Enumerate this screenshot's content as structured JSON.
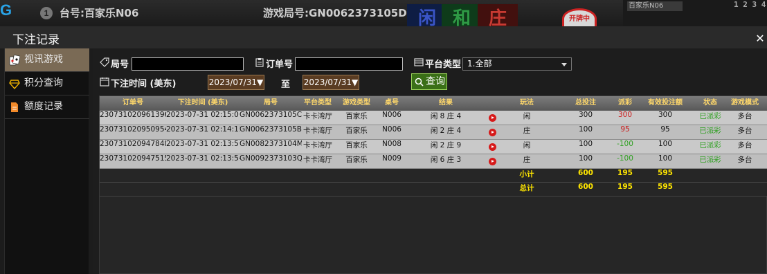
{
  "background": {
    "logo": "G",
    "table_badge_num": "1",
    "table_title": "台号:百家乐N06",
    "round_id": "游戏局号:GN0062373105D",
    "bet_player": "闲",
    "bet_tie": "和",
    "bet_banker": "庄",
    "badge_text": "开牌中",
    "right_label": "百家乐N06",
    "right_nums": "1 2 3 4"
  },
  "modal": {
    "title": "下注记录",
    "close_icon": "close-icon"
  },
  "sidebar": {
    "items": [
      {
        "label": "视讯游戏",
        "icon": "cards-icon",
        "active": true
      },
      {
        "label": "积分查询",
        "icon": "diamond-icon",
        "active": false
      },
      {
        "label": "额度记录",
        "icon": "document-icon",
        "active": false
      }
    ]
  },
  "filters": {
    "round_label": "局号",
    "order_label": "订单号",
    "platform_label": "平台类型",
    "platform_value": "1.全部",
    "time_label": "下注时间 (美东)",
    "date_from": "2023/07/31▼",
    "to_label": "至",
    "date_to": "2023/07/31▼",
    "query_label": "查询",
    "round_value": "",
    "order_value": ""
  },
  "table": {
    "columns": [
      "订单号",
      "下注时间 (美东)",
      "局号",
      "平台类型",
      "游戏类型",
      "桌号",
      "结果",
      "",
      "玩法",
      "总投注",
      "派彩",
      "有效投注额",
      "状态",
      "游戏模式"
    ],
    "rows": [
      {
        "order": "230731020961396",
        "time": "2023-07-31 02:15:01",
        "round": "GN0062373105C",
        "platform": "卡卡湾厅",
        "game": "百家乐",
        "table_no": "N006",
        "result": "闲 8 庄 4",
        "play": "闲",
        "bet": "300",
        "payout": "300",
        "payout_color": "#cc1b1b",
        "valid": "300",
        "status": "已派彩",
        "mode": "多台"
      },
      {
        "order": "230731020950954",
        "time": "2023-07-31 02:14:12",
        "round": "GN0062373105B",
        "platform": "卡卡湾厅",
        "game": "百家乐",
        "table_no": "N006",
        "result": "闲 2 庄 4",
        "play": "庄",
        "bet": "100",
        "payout": "95",
        "payout_color": "#cc1b1b",
        "valid": "95",
        "status": "已派彩",
        "mode": "多台"
      },
      {
        "order": "230731020947848",
        "time": "2023-07-31 02:13:57",
        "round": "GN0082373104M",
        "platform": "卡卡湾厅",
        "game": "百家乐",
        "table_no": "N008",
        "result": "闲 2 庄 9",
        "play": "闲",
        "bet": "100",
        "payout": "-100",
        "payout_color": "#2ea020",
        "valid": "100",
        "status": "已派彩",
        "mode": "多台"
      },
      {
        "order": "230731020947515",
        "time": "2023-07-31 02:13:54",
        "round": "GN0092373103Q",
        "platform": "卡卡湾厅",
        "game": "百家乐",
        "table_no": "N009",
        "result": "闲 6 庄 3",
        "play": "庄",
        "bet": "100",
        "payout": "-100",
        "payout_color": "#2ea020",
        "valid": "100",
        "status": "已派彩",
        "mode": "多台"
      }
    ],
    "subtotal": {
      "label": "小计",
      "bet": "600",
      "payout": "195",
      "valid": "595"
    },
    "total": {
      "label": "总计",
      "bet": "600",
      "payout": "195",
      "valid": "595"
    }
  }
}
